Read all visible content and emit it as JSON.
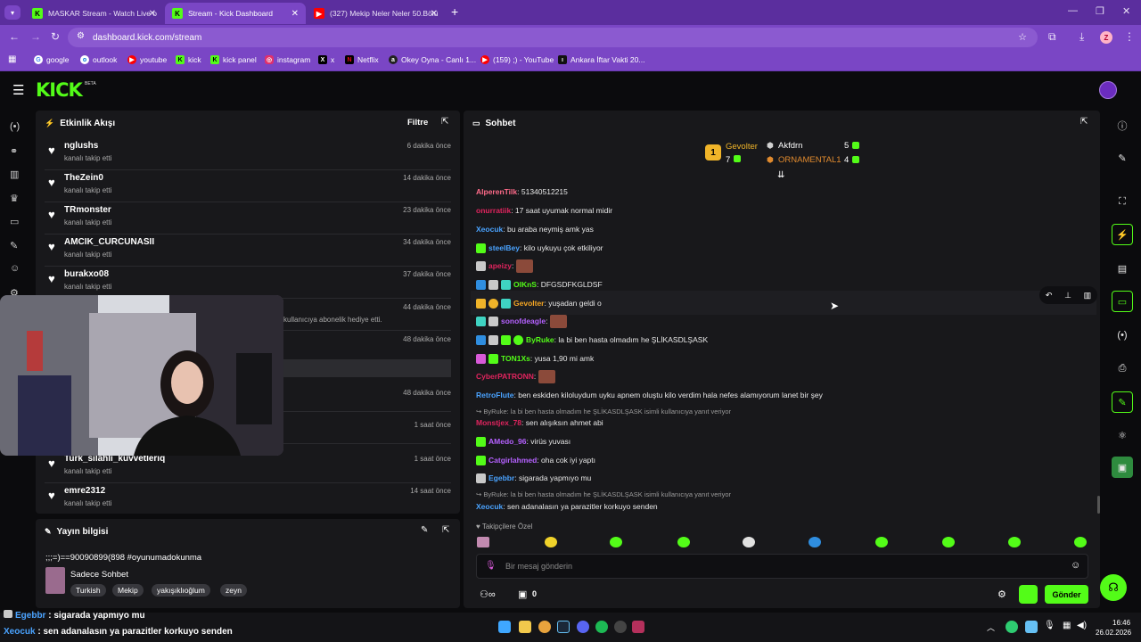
{
  "browser": {
    "tabs": [
      {
        "title": "MASKAR Stream - Watch Live o"
      },
      {
        "title": "Stream - Kick Dashboard"
      },
      {
        "title": "(327) Mekip Neler Neler 50.Bölü"
      }
    ],
    "url": "dashboard.kick.com/stream",
    "profile_initial": "Z",
    "bookmarks": [
      "google",
      "outlook",
      "youtube",
      "kick",
      "kick panel",
      "instagram",
      "x",
      "Netflix",
      "Okey Oyna - Canlı 1...",
      "(159) ;) - YouTube",
      "Ankara İftar Vakti 20..."
    ]
  },
  "header": {
    "logo": "KICK",
    "beta": "BETA"
  },
  "activity": {
    "title": "Etkinlik Akışı",
    "filter": "Filtre",
    "events": [
      {
        "name": "nglushs",
        "action": "kanalı takip etti",
        "time": "6 dakika önce"
      },
      {
        "name": "TheZein0",
        "action": "kanalı takip etti",
        "time": "14 dakika önce"
      },
      {
        "name": "TRmonster",
        "action": "kanalı takip etti",
        "time": "23 dakika önce"
      },
      {
        "name": "AMCIK_CURCUNASII",
        "action": "kanalı takip etti",
        "time": "34 dakika önce"
      },
      {
        "name": "burakxo08",
        "action": "kanalı takip etti",
        "time": "37 dakika önce"
      }
    ],
    "hidden_times": [
      "44 dakika önce",
      "48 dakika önce",
      "48 dakika önce",
      "1 saat önce",
      "1 saat önce"
    ],
    "gift_text": "kullanıcıya abonelik hediye etti.",
    "lower_events": [
      {
        "name": "Turk_silahli_kuvvetleriq",
        "action": "kanalı takip etti",
        "time": "1 saat önce"
      },
      {
        "name": "emre2312",
        "action": "kanalı takip etti",
        "time": "14 saat önce"
      }
    ]
  },
  "stream_info": {
    "title": "Yayın bilgisi",
    "stream_title": ";;;=)==90090899(898 #oyunumadokunma",
    "category": "Sadece Sohbet",
    "tags": [
      "Turkish",
      "Mekip",
      "yakışıklıoğlum",
      "zeyn"
    ]
  },
  "chat": {
    "title": "Sohbet",
    "leaderboard": [
      {
        "rank": "1",
        "name": "Gevolter",
        "count": "7"
      },
      {
        "name": "Akfdrn",
        "count": "5"
      },
      {
        "name": "ORNAMENTAL1",
        "count": "4"
      }
    ],
    "messages": [
      {
        "user": "AlperenTilk",
        "color": "#ff6b8a",
        "text": ": 51340512215"
      },
      {
        "user": "onurratiik",
        "color": "#e0245e",
        "text": ": 17 saat uyumak normal midir"
      },
      {
        "user": "Xeocuk",
        "color": "#4aa3ff",
        "text": ": bu araba neymiş amk yas"
      },
      {
        "user": "steelBey",
        "color": "#4aa3ff",
        "text": ": kilo uykuyu çok etkiliyor"
      },
      {
        "user": "apeizy",
        "color": "#e0245e",
        "text": ":"
      },
      {
        "user": "OlKnS",
        "color": "#53fc18",
        "text": ": DFGSDFKGLDSF"
      },
      {
        "user": "Gevolter",
        "color": "#f5a623",
        "text": ": yuşadan geldi o"
      },
      {
        "user": "sonofdeagle",
        "color": "#b561ff",
        "text": ":"
      },
      {
        "user": "ByRuke",
        "color": "#53fc18",
        "text": ": la bi ben hasta olmadım he ŞLİKASDLŞASK"
      },
      {
        "user": "TON1Xs",
        "color": "#53fc18",
        "text": ": yusa 1,90 mi amk"
      },
      {
        "user": "CyberPATRONN",
        "color": "#e0245e",
        "text": ":"
      },
      {
        "user": "RetroFlute",
        "color": "#4aa3ff",
        "text": ": ben eskiden kiloluydum uyku apnem oluştu kilo verdim hala nefes alamıyorum lanet bir şey"
      },
      {
        "user": "Monstjex_78",
        "color": "#e0245e",
        "text": ": sen alışıksın ahmet abi"
      },
      {
        "user": "AMedo_96",
        "color": "#b561ff",
        "text": ": virüs yuvası"
      },
      {
        "user": "Catgirlahmed",
        "color": "#b561ff",
        "text": ": oha cok iyi yaptı"
      },
      {
        "user": "Egebbr",
        "color": "#4aa3ff",
        "text": ": sigarada yapmıyo mu"
      },
      {
        "user": "Xeocuk",
        "color": "#4aa3ff",
        "text": ": sen adanalasın ya parazitler korkuyo senden"
      }
    ],
    "reply_1": "ByRuke: la bi ben hasta olmadım he ŞLİKASDLŞASK isimli kullanıcıya yanıt veriyor",
    "reply_2": "ByRuke: la bi ben hasta olmadım he ŞLİKASDLŞASK isimli kullanıcıya yanıt veriyor",
    "emote_section": "Takipçilere Özel",
    "input_placeholder": "Bir mesaj gönderin",
    "viewer_count": "0",
    "send_label": "Gönder"
  },
  "overlay": {
    "line1_user": "Egebbr",
    "line1_text": " : sigarada yapmıyo mu",
    "line2_user": "Xeocuk",
    "line2_text": " : sen adanalasın ya parazitler korkuyo senden"
  },
  "taskbar": {
    "time": "16:46",
    "date": "26.02.2026"
  }
}
